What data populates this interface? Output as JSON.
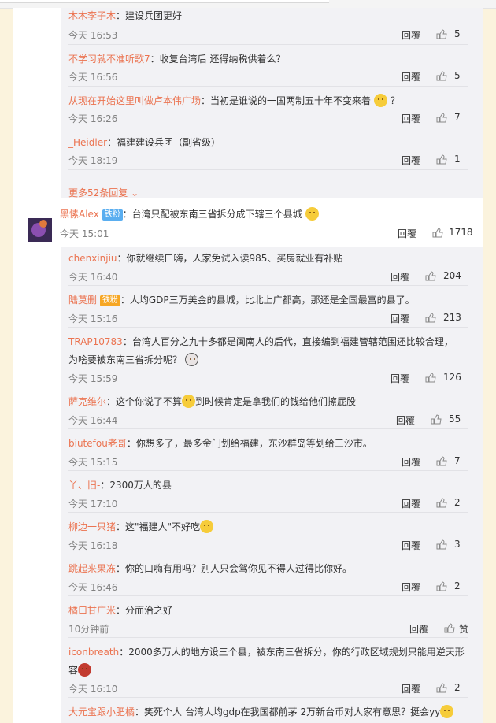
{
  "labels": {
    "reply": "回覆",
    "chevron": "⌄"
  },
  "top_comments": [
    {
      "user": "木木李子木",
      "text": "：建设兵团更好",
      "time": "今天 16:53",
      "likes": "5"
    },
    {
      "user": "不学习就不准听歌7",
      "text": "：收复台湾后 还得纳税供着么？",
      "time": "今天 16:56",
      "likes": "5"
    },
    {
      "user": "从现在开始这里叫做卢本伟广场",
      "text": "：当初是谁说的一国两制五十年不变来着",
      "text_after": "？",
      "time": "今天 16:26",
      "likes": "7"
    },
    {
      "user": "_Heidler",
      "text": "：福建建设兵团（副省级）",
      "time": "今天 18:19",
      "likes": "1"
    }
  ],
  "more_replies": "更多52条回复",
  "main_comment": {
    "user": "黑愫Alex",
    "badge": "铁粉",
    "text": "：台湾只配被东南三省拆分成下辖三个县城",
    "time": "今天 15:01",
    "likes": "1718"
  },
  "replies": [
    {
      "user": "chenxinjiu",
      "text": "：你就继续口嗨，人家免试入读985、买房就业有补贴",
      "time": "今天 16:40",
      "likes": "204"
    },
    {
      "user": "陆莫删",
      "badge": "铁粉",
      "text": "：人均GDP三万美金的县城，比北上广都高，那还是全国最富的县了。",
      "time": "今天 15:16",
      "likes": "213"
    },
    {
      "user": "TRAP10783",
      "text": "：台湾人百分之九十多都是闽南人的后代，直接编到福建管辖范围还比较合理，",
      "line2": "为啥要被东南三省拆分呢？",
      "time": "今天 15:59",
      "likes": "126"
    },
    {
      "user": "萨克维尔",
      "text": "：这个你说了不算",
      "text_after": "到时候肯定是拿我们的钱给他们擦屁股",
      "time": "今天 16:44",
      "likes": "55"
    },
    {
      "user": "biutefou老哥",
      "text": "：你想多了，最多金门划给福建，东沙群岛等划给三沙市。",
      "time": "今天 15:15",
      "likes": "7"
    },
    {
      "user": "丫、旧-",
      "text": "：2300万人的县",
      "time": "今天 17:10",
      "likes": "2"
    },
    {
      "user": "柳边一只猪",
      "text": "：这\"福建人\"不好吃",
      "time": "今天 16:18",
      "likes": "3"
    },
    {
      "user": "跳起来果冻",
      "text": "：你的口嗨有用吗？别人只会驾你见不得人过得比你好。",
      "time": "今天 16:46",
      "likes": "2"
    },
    {
      "user": "橘口甘广米",
      "text": "：分而治之好",
      "time": "10分钟前",
      "likes": "赞"
    },
    {
      "user": "iconbreath",
      "text": "：2000多万人的地方设三个县，被东南三省拆分，你的行政区域规划只能用逆天形",
      "line2": "容",
      "time": "今天 16:10",
      "likes": "2"
    },
    {
      "user": "大元宝跟小肥橘",
      "text": "：笑死个人 台湾人均gdp在我国都前茅 2万新台币对人家有意思？挺会yy",
      "time": "",
      "likes": ""
    }
  ]
}
